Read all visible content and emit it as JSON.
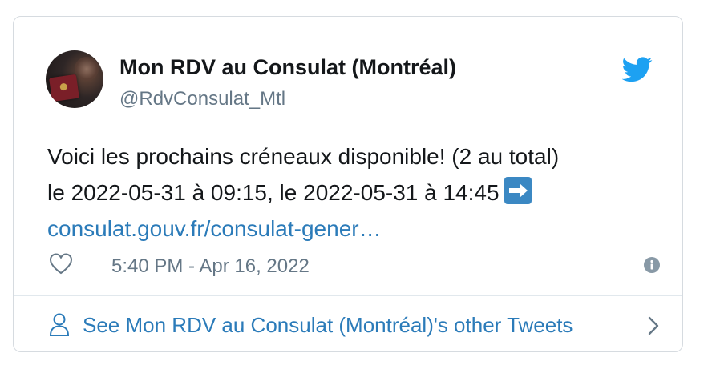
{
  "tweet": {
    "author": {
      "display_name": "Mon RDV au Consulat (Montréal)",
      "handle": "@RdvConsulat_Mtl"
    },
    "text_line1": "Voici les prochains créneaux disponible! (2 au total)",
    "text_line2": "le 2022-05-31 à 09:15, le 2022-05-31 à 14:45",
    "link_text": "consulat.gouv.fr/consulat-gener…",
    "timestamp": "5:40 PM - Apr 16, 2022"
  },
  "footer": {
    "label": "See Mon RDV au Consulat (Montréal)'s other Tweets"
  },
  "icons": {
    "brand": "twitter-bird-icon",
    "emoji": "right-arrow-emoji",
    "like": "heart-icon",
    "info": "info-icon",
    "person": "person-icon",
    "chevron": "chevron-right-icon"
  },
  "colors": {
    "twitter_blue": "#1da1f2",
    "link": "#2b7bb9",
    "text": "#14171a",
    "muted": "#657786",
    "border": "#d6dbe0",
    "emoji_blue": "#3b88c3"
  }
}
